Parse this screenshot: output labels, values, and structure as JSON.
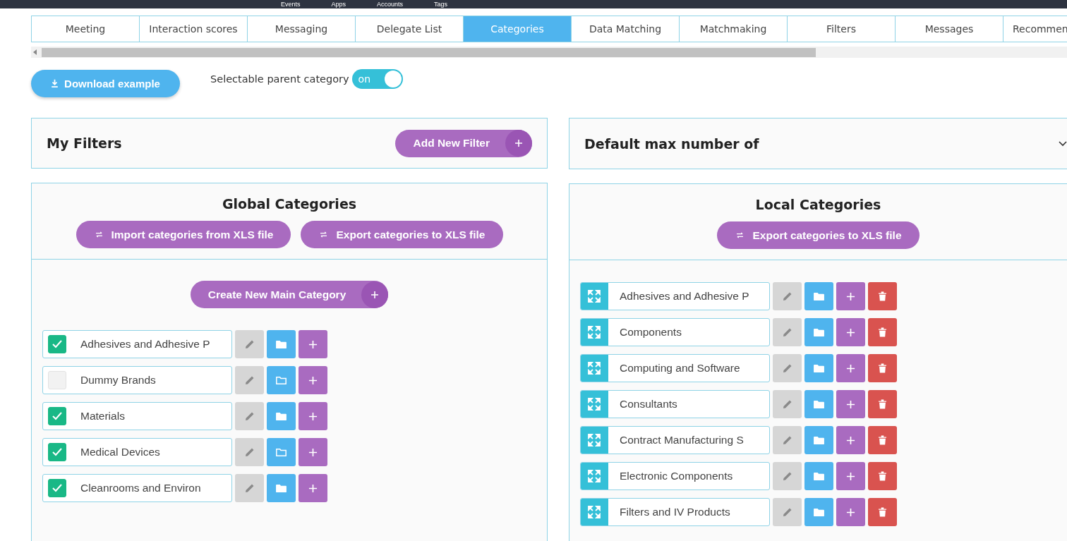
{
  "top_nav": [
    "Events",
    "Apps",
    "Accounts",
    "Tags"
  ],
  "tabs": [
    {
      "label": "Meeting",
      "selected": false
    },
    {
      "label": "Interaction scores",
      "selected": false
    },
    {
      "label": "Messaging",
      "selected": false
    },
    {
      "label": "Delegate List",
      "selected": false
    },
    {
      "label": "Categories",
      "selected": true
    },
    {
      "label": "Data Matching",
      "selected": false
    },
    {
      "label": "Matchmaking",
      "selected": false
    },
    {
      "label": "Filters",
      "selected": false
    },
    {
      "label": "Messages",
      "selected": false
    },
    {
      "label": "Recommen",
      "selected": false
    }
  ],
  "download_button": "Download example",
  "parent_toggle": {
    "label": "Selectable parent category",
    "state_text": "on",
    "on": true
  },
  "my_filters": {
    "title": "My Filters",
    "add_button": "Add New Filter"
  },
  "default_max": {
    "title": "Default max number of"
  },
  "global_categories": {
    "title": "Global Categories",
    "buttons": [
      "Import categories from XLS file",
      "Export categories to XLS file"
    ],
    "create_button": "Create New Main Category",
    "items": [
      {
        "name": "Adhesives and Adhesive P",
        "checked": true,
        "has_subcategories": true
      },
      {
        "name": "Dummy Brands",
        "checked": false,
        "has_subcategories": false
      },
      {
        "name": "Materials",
        "checked": true,
        "has_subcategories": true
      },
      {
        "name": "Medical Devices",
        "checked": true,
        "has_subcategories": false
      },
      {
        "name": "Cleanrooms and Environ",
        "checked": true,
        "has_subcategories": true
      }
    ]
  },
  "local_categories": {
    "title": "Local Categories",
    "buttons": [
      "Export categories to XLS file"
    ],
    "items": [
      {
        "name": "Adhesives and Adhesive P"
      },
      {
        "name": "Components"
      },
      {
        "name": "Computing and Software"
      },
      {
        "name": "Consultants"
      },
      {
        "name": "Contract Manufacturing S"
      },
      {
        "name": "Electronic Components"
      },
      {
        "name": "Filters and IV Products"
      }
    ]
  }
}
